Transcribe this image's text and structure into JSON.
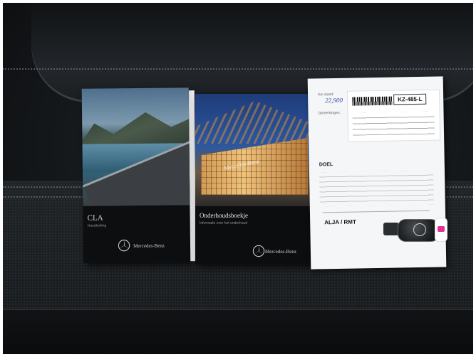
{
  "scene": {
    "description_hidden": "",
    "booklet1": {
      "title": "CLA",
      "subtitle": "Handleiding",
      "brand": "Mercedes-Benz"
    },
    "booklet2": {
      "title": "Onderhoudsboekje",
      "subtitle": "Informatie over het onderhoud",
      "brand": "Mercedes-Benz",
      "sign": "Mercedes-Benz"
    },
    "sheet": {
      "km_label": "Km stand:",
      "km_value": "22,900",
      "remarks_label": "Opmerkingen:",
      "plate": "KZ-485-L",
      "purpose_label": "DOEL",
      "signature": "ALJA / RMT"
    }
  }
}
